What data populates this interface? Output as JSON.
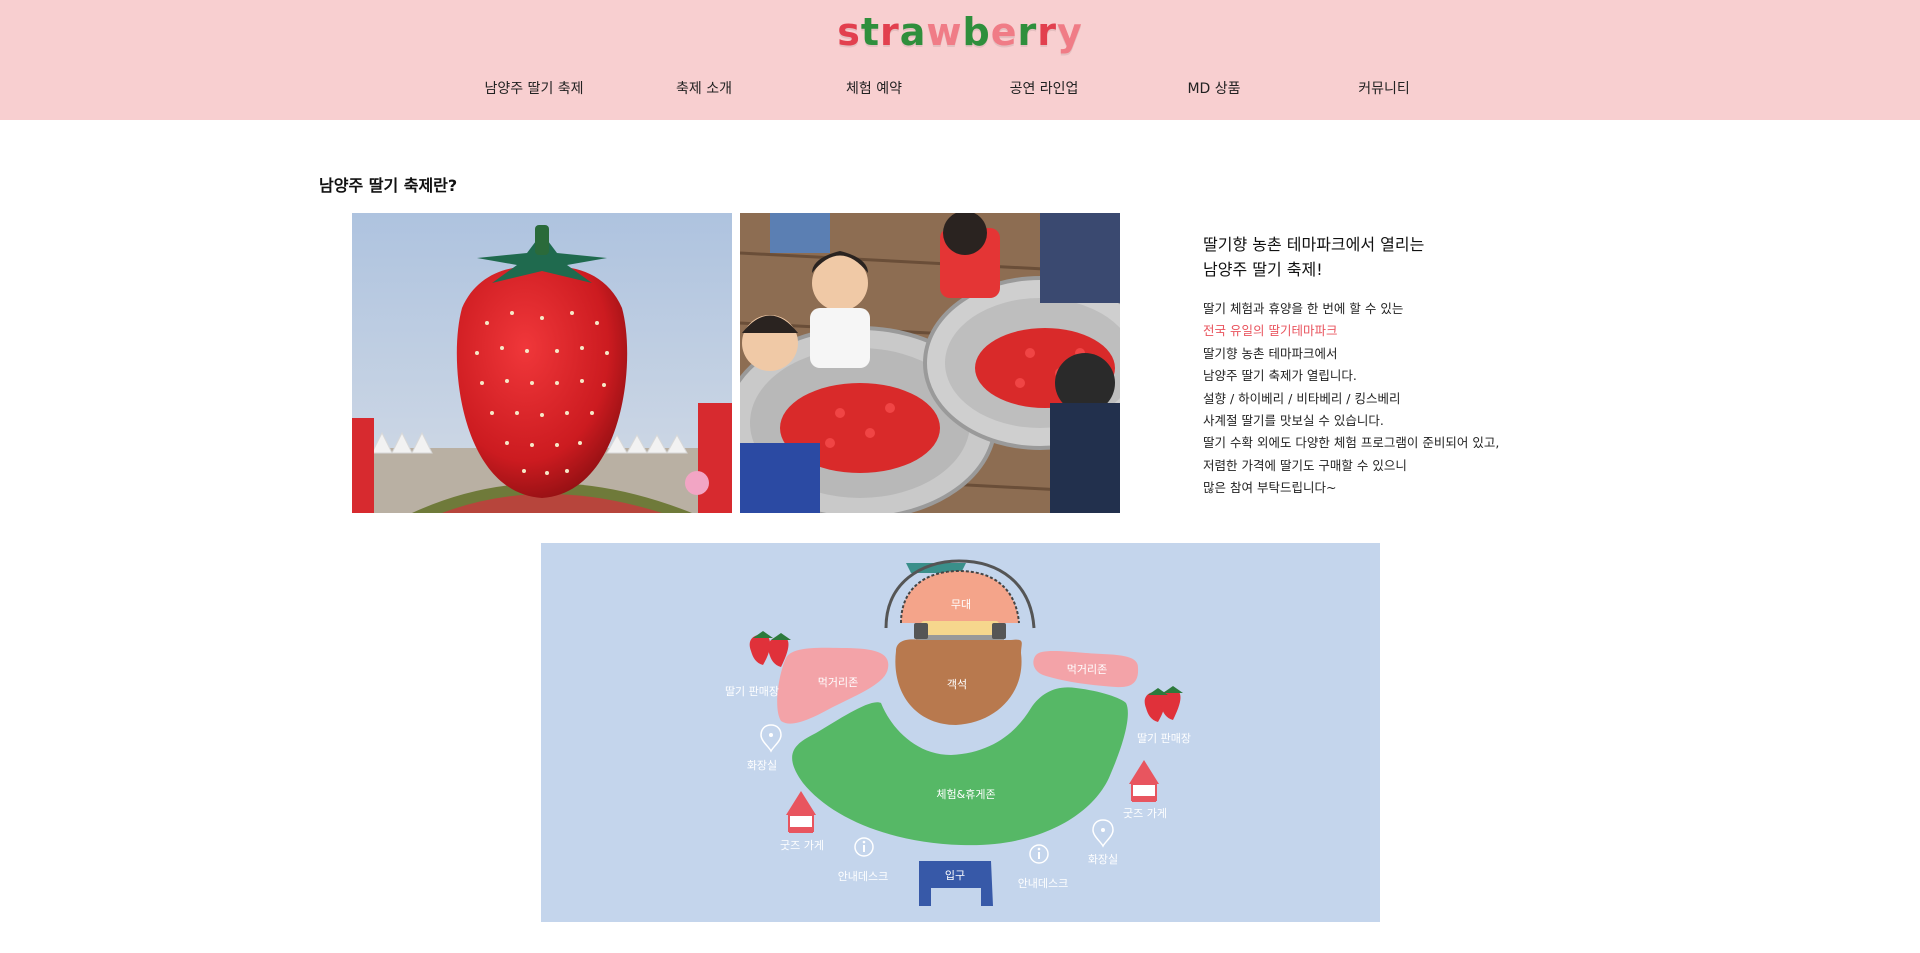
{
  "logo": {
    "letters": [
      "s",
      "t",
      "r",
      "a",
      "w",
      "b",
      "e",
      "r",
      "r",
      "y"
    ]
  },
  "nav": {
    "items": [
      {
        "label": "남양주 딸기 축제"
      },
      {
        "label": "축제 소개"
      },
      {
        "label": "체험 예약"
      },
      {
        "label": "공연 라인업"
      },
      {
        "label": "MD 상품"
      },
      {
        "label": "커뮤니티"
      }
    ]
  },
  "about": {
    "title": "남양주 딸기 축제란?",
    "heading_line1": "딸기향 농촌 테마파크에서 열리는",
    "heading_line2": "남양주 딸기 축제!",
    "body": [
      "딸기 체험과 휴양을 한 번에 할 수 있는",
      "전국 유일의 딸기테마파크",
      "딸기향 농촌 테마파크에서",
      "남양주 딸기 축제가 열립니다.",
      "설향 / 하이베리 / 비타베리 / 킹스베리",
      "사계절 딸기를 맛보실 수 있습니다.",
      "딸기 수확 외에도 다양한 체험 프로그램이 준비되어 있고,",
      "저렴한 가격에 딸기도 구매할 수 있으니",
      "많은 참여 부탁드립니다~"
    ],
    "highlight_color": "#e9545e"
  },
  "map": {
    "labels": {
      "stage": "무대",
      "seats": "객석",
      "food_left": "먹거리존",
      "food_right": "먹거리존",
      "experience": "체험&휴게존",
      "entrance": "입구",
      "shop_left": "딸기 판매장",
      "shop_right": "딸기 판매장",
      "restroom_left": "화장실",
      "restroom_right": "화장실",
      "goods_left": "굿즈 가게",
      "goods_right": "굿즈 가게",
      "info_left": "안내데스크",
      "info_right": "안내데스크"
    },
    "colors": {
      "background": "#c4d5ec",
      "stage": "#f4a48a",
      "seats": "#b8794e",
      "food": "#f3a3a8",
      "experience": "#56b866",
      "entrance": "#3759a8"
    }
  },
  "colors": {
    "header_bg": "#f8cfd0",
    "accent": "#e9545e"
  }
}
